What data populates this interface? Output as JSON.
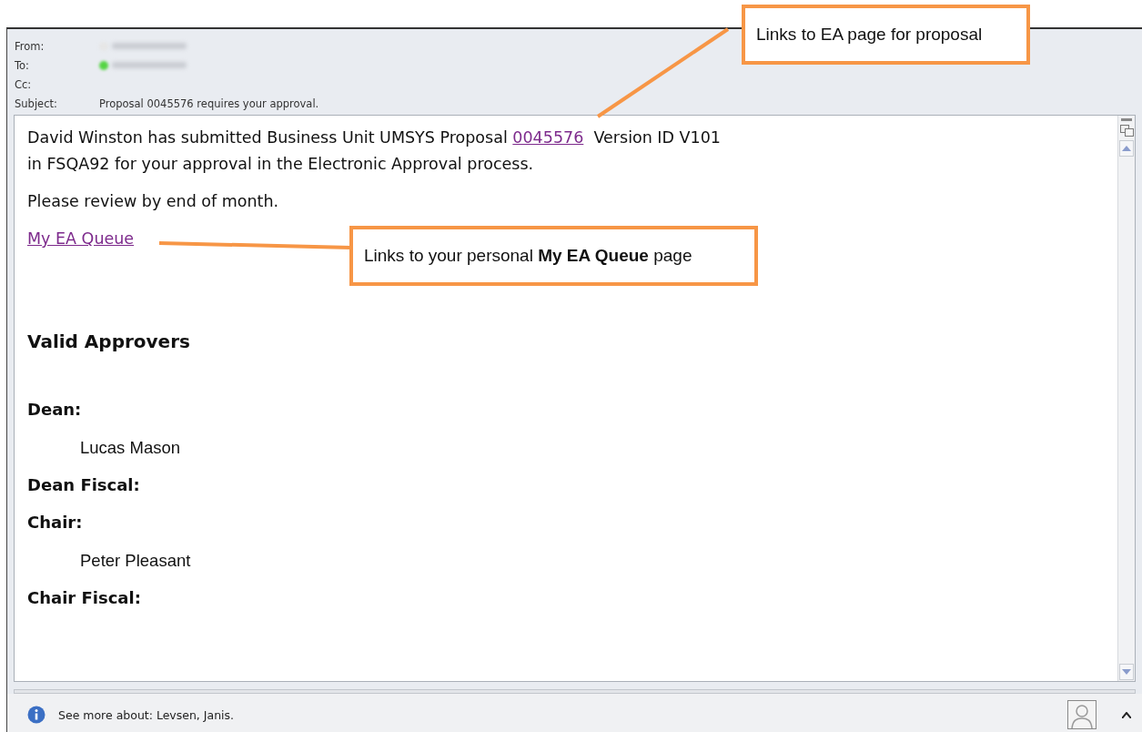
{
  "header": {
    "fields": [
      {
        "label": "From:",
        "kind": "redacted",
        "presence": false
      },
      {
        "label": "To:",
        "kind": "redacted",
        "presence": true
      },
      {
        "label": "Cc:",
        "kind": "empty"
      },
      {
        "label": "Subject:",
        "kind": "text",
        "value": "Proposal 0045576 requires your approval."
      }
    ]
  },
  "body": {
    "intro": {
      "before": "David Winston has submitted Business Unit UMSYS Proposal",
      "link": "0045576",
      "after": "Version ID V101 in FSQA92 for your approval in the Electronic Approval process."
    },
    "note": "Please review by end of month.",
    "queue_link": "My EA Queue",
    "approvers_heading": "Valid Approvers",
    "roles": [
      {
        "role": "Dean:",
        "names": [
          "Lucas Mason"
        ]
      },
      {
        "role": "Dean Fiscal:"
      },
      {
        "role": "Chair:",
        "names": [
          "Peter Pleasant"
        ]
      },
      {
        "role": "Chair Fiscal:"
      }
    ]
  },
  "status_bar": {
    "text": "See more about: Levsen, Janis."
  },
  "callouts": [
    {
      "text": "Links to EA page for proposal"
    },
    {
      "text": "Links to your personal **My EA Queue** page"
    }
  ]
}
